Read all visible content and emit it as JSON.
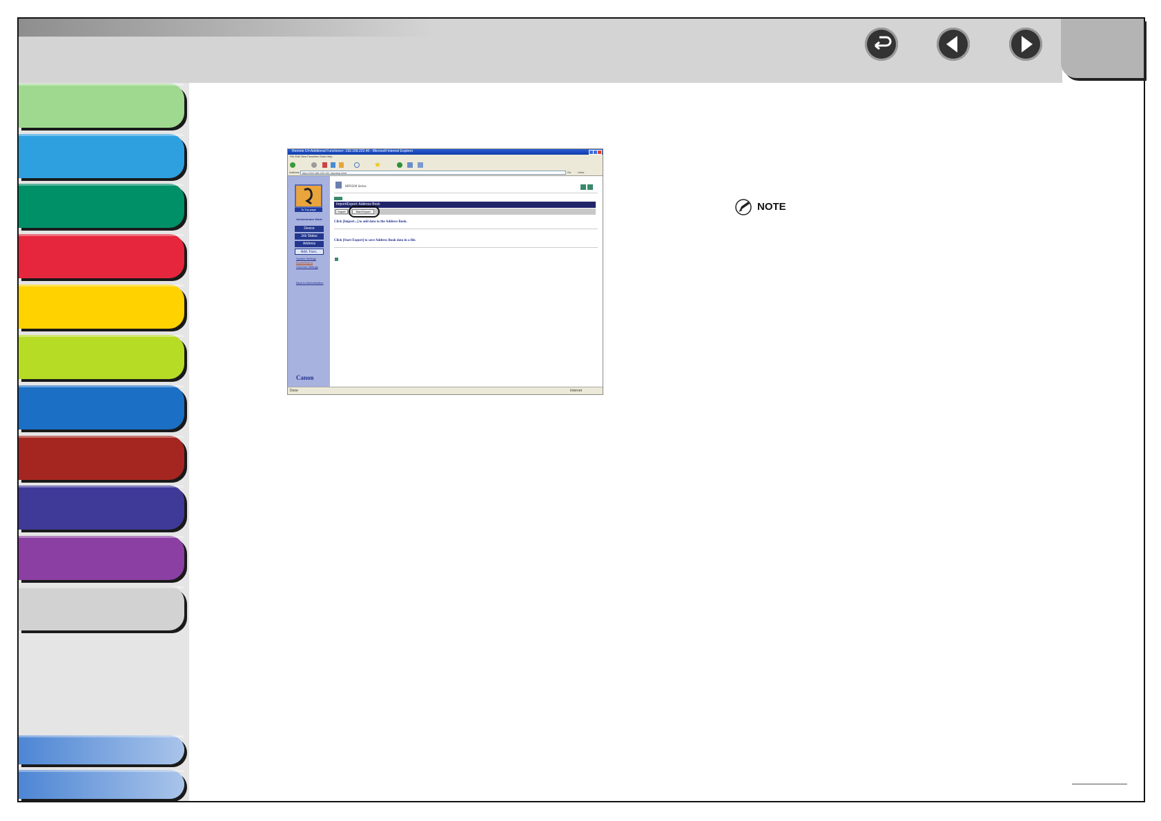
{
  "toolbar": {
    "back_icon": "return-icon",
    "prev_icon": "previous-page-icon",
    "next_icon": "next-page-icon"
  },
  "chapter_tabs": [
    {
      "color": "#9fd98f"
    },
    {
      "color": "#2ea0e0"
    },
    {
      "color": "#009068"
    },
    {
      "color": "#e5263c"
    },
    {
      "color": "#ffd200"
    },
    {
      "color": "#b7dc26"
    },
    {
      "color": "#1b6fc5"
    },
    {
      "color": "#a52620"
    },
    {
      "color": "#3f3a98"
    },
    {
      "color": "#8c3fa2"
    },
    {
      "color": "#d2d2d2"
    }
  ],
  "bottom_tabs": [
    {
      "color": "#4d86d4"
    },
    {
      "color": "#4d86d4"
    }
  ],
  "screenshot": {
    "window_title": "Remote UI<Additional Functions>: 192.168.222.40 - Microsoft Internet Explorer",
    "menu": "File  Edit  View  Favorites  Tools  Help",
    "address_label": "Address",
    "address_value": "http://192.168.222.40/_imp/exp.html",
    "go_label": "Go",
    "links_label": "Links",
    "device_title": "MF6500 Series",
    "section_header": "Import/Export: Address Book",
    "import_button": "Import",
    "start_export_button": "Start Export",
    "import_text": "Click [Import...] to add data to the Address Book.",
    "export_text": "Click [Start Export] to save Address Book data in a file.",
    "portal_caption": "To Top page",
    "mode_label": "Administrator Mode",
    "nav": [
      "Device",
      "Job Status",
      "Address",
      "Add. Func."
    ],
    "sub_links": [
      "System Settings",
      "Import/Export",
      "Common Settings"
    ],
    "back_link": "Back to Administration",
    "logo": "Canon",
    "status_left": "Done",
    "status_right": "Internet"
  },
  "note": {
    "label": "NOTE",
    "icon": "pencil-note-icon"
  }
}
